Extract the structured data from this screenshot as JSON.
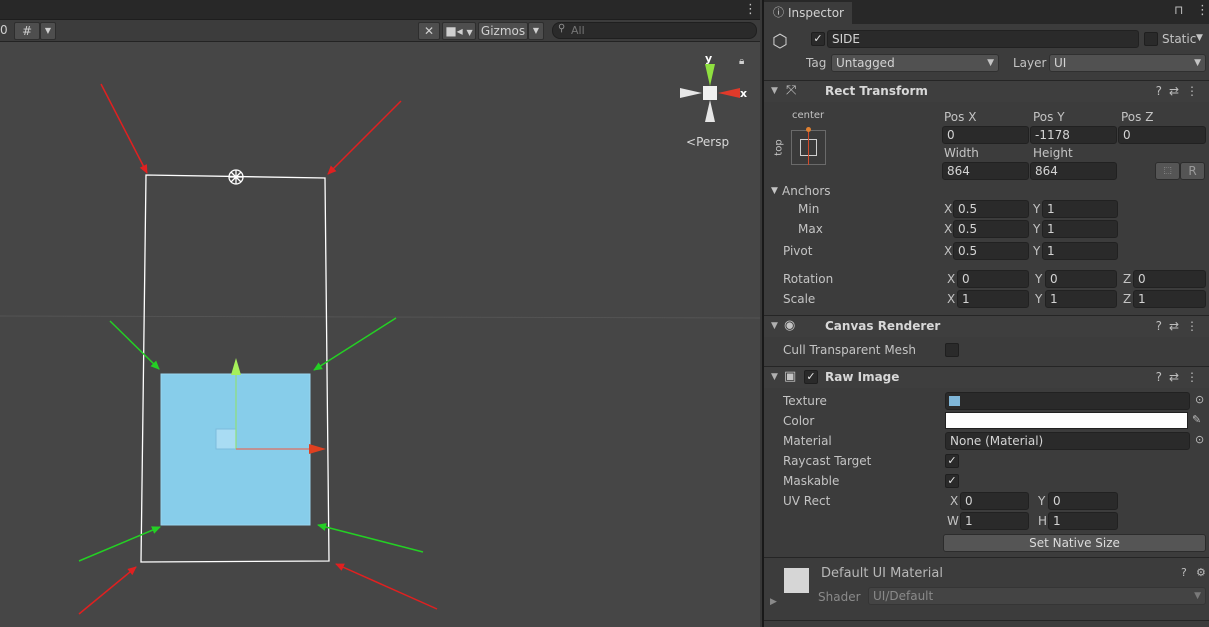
{
  "scene": {
    "toolbar": {
      "grid_snap_value": "0",
      "gizmos_label": "Gizmos",
      "search_placeholder": "All"
    },
    "view_mode": "Persp",
    "axis_labels": {
      "y": "y",
      "x": "x"
    }
  },
  "inspector": {
    "tab_label": "Inspector",
    "object": {
      "active": true,
      "name": "SIDE",
      "static_label": "Static",
      "tag_label": "Tag",
      "tag_value": "Untagged",
      "layer_label": "Layer",
      "layer_value": "UI"
    },
    "rect_transform": {
      "title": "Rect Transform",
      "anchor_preset_h": "center",
      "anchor_preset_v": "top",
      "pos_x_label": "Pos X",
      "pos_x": "0",
      "pos_y_label": "Pos Y",
      "pos_y": "-1178",
      "pos_z_label": "Pos Z",
      "pos_z": "0",
      "width_label": "Width",
      "width": "864",
      "height_label": "Height",
      "height": "864",
      "raw_button": "R",
      "anchors_label": "Anchors",
      "min_label": "Min",
      "min_x": "0.5",
      "min_y": "1",
      "max_label": "Max",
      "max_x": "0.5",
      "max_y": "1",
      "pivot_label": "Pivot",
      "pivot_x": "0.5",
      "pivot_y": "1",
      "rotation_label": "Rotation",
      "rot_x": "0",
      "rot_y": "0",
      "rot_z": "0",
      "scale_label": "Scale",
      "scale_x": "1",
      "scale_y": "1",
      "scale_z": "1",
      "x": "X",
      "y": "Y",
      "z": "Z"
    },
    "canvas_renderer": {
      "title": "Canvas Renderer",
      "cull_label": "Cull Transparent Mesh",
      "cull_checked": false
    },
    "raw_image": {
      "title": "Raw Image",
      "enabled": true,
      "texture_label": "Texture",
      "texture_color": "#7fb6d8",
      "color_label": "Color",
      "color_value": "#ffffff",
      "material_label": "Material",
      "material_value": "None (Material)",
      "raycast_label": "Raycast Target",
      "raycast_checked": true,
      "maskable_label": "Maskable",
      "maskable_checked": true,
      "uvrect_label": "UV Rect",
      "uv_x": "0",
      "uv_y": "0",
      "uv_w": "1",
      "uv_h": "1",
      "w": "W",
      "h": "H",
      "native_size_button": "Set Native Size"
    },
    "material": {
      "name": "Default UI Material",
      "shader_label": "Shader",
      "shader_value": "UI/Default"
    }
  },
  "colors": {
    "image_fill": "#87cdea",
    "red_arrow": "#e02020",
    "green_arrow": "#24d024"
  }
}
